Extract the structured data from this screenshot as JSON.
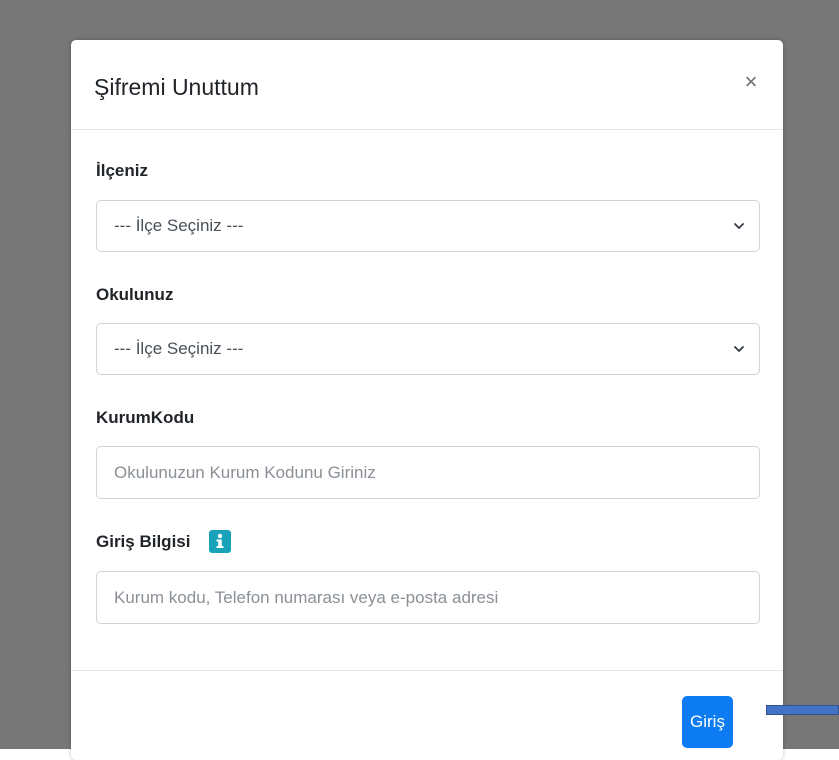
{
  "modal": {
    "title": "Şifremi Unuttum",
    "close_label": "×"
  },
  "fields": {
    "district": {
      "label": "İlçeniz",
      "selected": "--- İlçe Seçiniz ---"
    },
    "school": {
      "label": "Okulunuz",
      "selected": "--- İlçe Seçiniz ---"
    },
    "institution_code": {
      "label": "KurumKodu",
      "placeholder": "Okulunuzun Kurum Kodunu Giriniz",
      "value": ""
    },
    "login_info": {
      "label": "Giriş Bilgisi",
      "placeholder": "Kurum kodu, Telefon numarası veya e-posta adresi",
      "value": ""
    }
  },
  "footer": {
    "submit_label": "Giriş"
  },
  "icons": {
    "close": "close-icon",
    "select_chevron": "chevron-down-icon",
    "info": "info-icon"
  },
  "colors": {
    "backdrop": "#777777",
    "primary": "#0d7cf2",
    "info": "#17a2b8",
    "annotation_arrow": "#4472c4"
  }
}
